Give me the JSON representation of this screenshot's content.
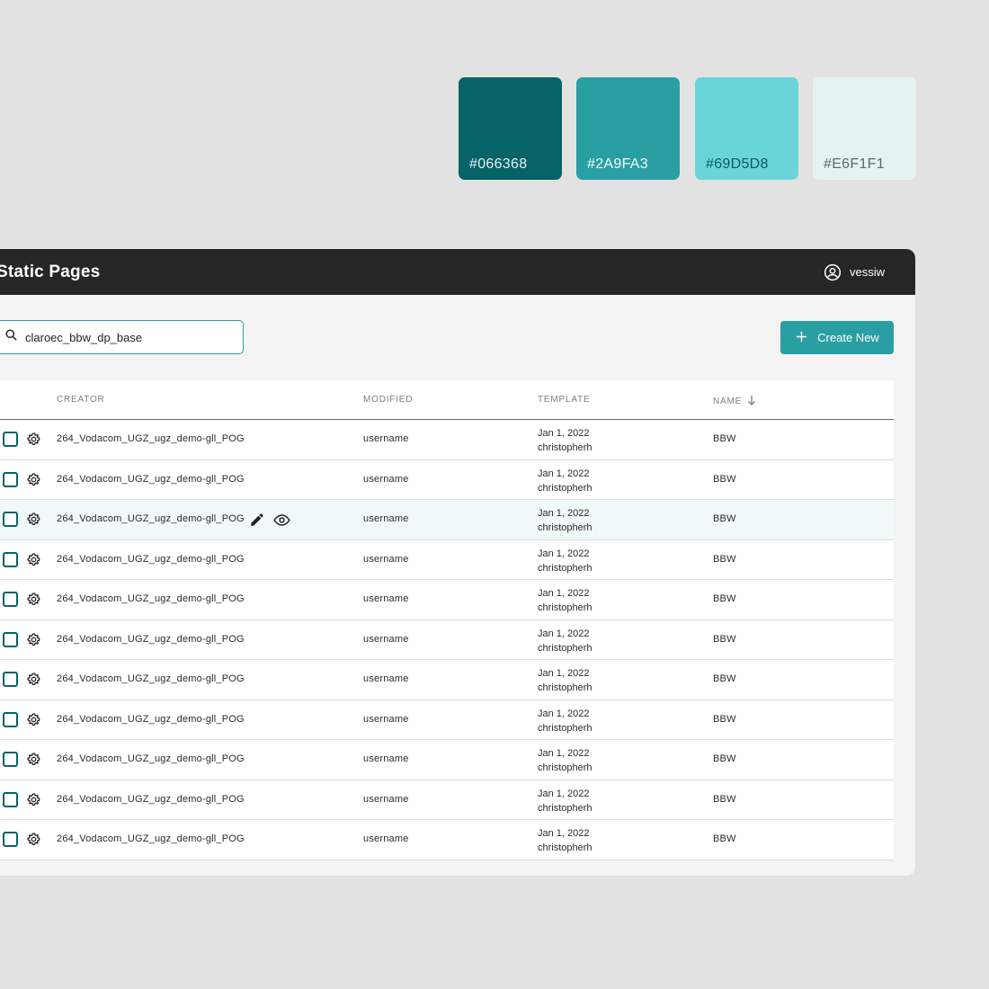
{
  "swatches": [
    {
      "hex": "#066368",
      "label": "#066368"
    },
    {
      "hex": "#2A9FA3",
      "label": "#2A9FA3"
    },
    {
      "hex": "#69D5D8",
      "label": "#69D5D8"
    },
    {
      "hex": "#E6F1F1",
      "label": "#E6F1F1"
    }
  ],
  "header": {
    "title": "Static Pages",
    "user": "vessiw",
    "user_icon": "account-circle-icon"
  },
  "search": {
    "value": "claroec_bbw_dp_base",
    "icon": "search-icon"
  },
  "actions": {
    "create_label": "Create New",
    "create_icon": "plus-icon"
  },
  "table": {
    "columns": {
      "creator": "CREATOR",
      "modified": "MODIFIED",
      "template": "TEMPLATE",
      "name": "NAME"
    },
    "sort": {
      "column": "name",
      "direction": "descending",
      "icon": "arrow-down-icon"
    },
    "hovered_row": 2,
    "rows": [
      {
        "creator": "264_Vodacom_UGZ_ugz_demo-gll_POG",
        "modified": "username",
        "template_date": "Jan 1, 2022",
        "template_user": "christopherh",
        "name": "BBW"
      },
      {
        "creator": "264_Vodacom_UGZ_ugz_demo-gll_POG",
        "modified": "username",
        "template_date": "Jan 1, 2022",
        "template_user": "christopherh",
        "name": "BBW"
      },
      {
        "creator": "264_Vodacom_UGZ_ugz_demo-gll_POG",
        "modified": "username",
        "template_date": "Jan 1, 2022",
        "template_user": "christopherh",
        "name": "BBW"
      },
      {
        "creator": "264_Vodacom_UGZ_ugz_demo-gll_POG",
        "modified": "username",
        "template_date": "Jan 1, 2022",
        "template_user": "christopherh",
        "name": "BBW"
      },
      {
        "creator": "264_Vodacom_UGZ_ugz_demo-gll_POG",
        "modified": "username",
        "template_date": "Jan 1, 2022",
        "template_user": "christopherh",
        "name": "BBW"
      },
      {
        "creator": "264_Vodacom_UGZ_ugz_demo-gll_POG",
        "modified": "username",
        "template_date": "Jan 1, 2022",
        "template_user": "christopherh",
        "name": "BBW"
      },
      {
        "creator": "264_Vodacom_UGZ_ugz_demo-gll_POG",
        "modified": "username",
        "template_date": "Jan 1, 2022",
        "template_user": "christopherh",
        "name": "BBW"
      },
      {
        "creator": "264_Vodacom_UGZ_ugz_demo-gll_POG",
        "modified": "username",
        "template_date": "Jan 1, 2022",
        "template_user": "christopherh",
        "name": "BBW"
      },
      {
        "creator": "264_Vodacom_UGZ_ugz_demo-gll_POG",
        "modified": "username",
        "template_date": "Jan 1, 2022",
        "template_user": "christopherh",
        "name": "BBW"
      },
      {
        "creator": "264_Vodacom_UGZ_ugz_demo-gll_POG",
        "modified": "username",
        "template_date": "Jan 1, 2022",
        "template_user": "christopherh",
        "name": "BBW"
      },
      {
        "creator": "264_Vodacom_UGZ_ugz_demo-gll_POG",
        "modified": "username",
        "template_date": "Jan 1, 2022",
        "template_user": "christopherh",
        "name": "BBW"
      }
    ]
  }
}
